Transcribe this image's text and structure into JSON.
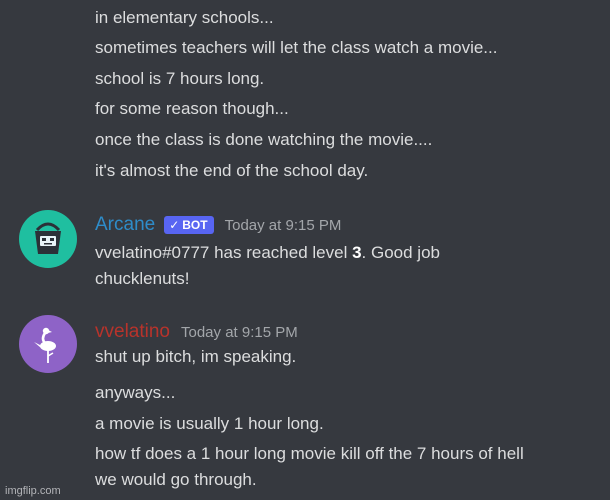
{
  "colors": {
    "background": "#36393f",
    "text": "#dcddde",
    "timestamp": "#a3a6aa",
    "bot_username": "#2e8cc9",
    "user_username": "#b8332b",
    "bot_tag_bg": "#5865f2",
    "bot_avatar_bg": "#1fbfa0",
    "user_avatar_bg": "#8e63c7"
  },
  "continued_messages": [
    "in elementary schools...",
    "sometimes teachers will let the class watch a movie...",
    "school is 7 hours long.",
    "for some reason though...",
    "once the class is done watching the movie....",
    "it's almost the end of the school day."
  ],
  "bot_message": {
    "username": "Arcane",
    "bot_tag": "BOT",
    "bot_tag_icon": "checkmark-icon",
    "timestamp": "Today at 9:15 PM",
    "avatar_icon": "bucket-robot-avatar",
    "line1_pre": "vvelatino#0777 has reached level ",
    "line1_level": "3",
    "line1_post": ". Good job",
    "line2": "chucklenuts!"
  },
  "user_message": {
    "username": "vvelatino",
    "timestamp": "Today at 9:15 PM",
    "avatar_icon": "flamingo-avatar",
    "lines": [
      "shut up bitch, im speaking.",
      "anyways...",
      "a movie is usually 1 hour long.",
      "how tf does a 1 hour long movie kill off the 7 hours of hell",
      "we would go through."
    ]
  },
  "watermark": "imgflip.com"
}
